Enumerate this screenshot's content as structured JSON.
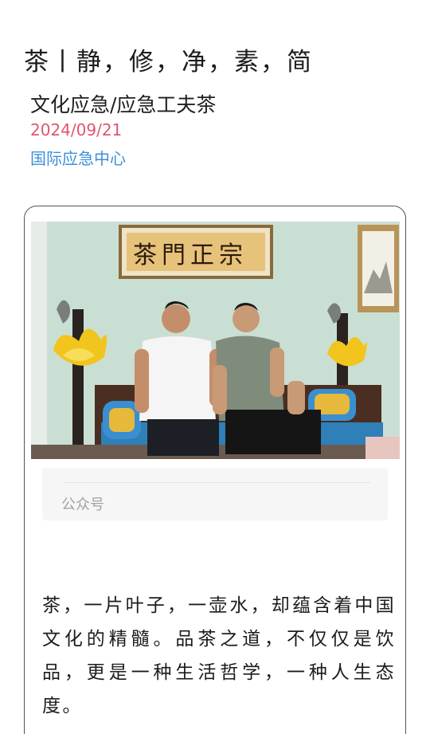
{
  "article": {
    "title": "茶丨静，修，净，素，简",
    "subtitle": "文化应急/应急工夫茶",
    "date": "2024/09/21",
    "source": "国际应急中心"
  },
  "photo": {
    "calligraphy": "茶門正宗",
    "alt_icon": "tea-room-photo"
  },
  "embed": {
    "label": "公众号"
  },
  "body": {
    "paragraph": "茶，一片叶子，一壶水，却蕴含着中国文化的精髓。品茶之道，不仅仅是饮品，更是一种生活哲学，一种人生态度。"
  }
}
